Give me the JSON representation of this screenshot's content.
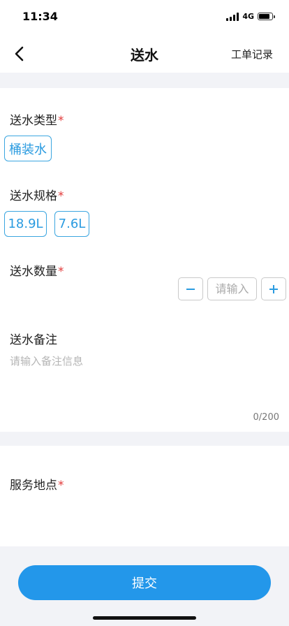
{
  "status_bar": {
    "time": "11:34",
    "network": "4G"
  },
  "nav": {
    "title": "送水",
    "action_label": "工单记录"
  },
  "form": {
    "water_type": {
      "label": "送水类型",
      "required_mark": "*",
      "options": [
        "桶装水"
      ]
    },
    "water_spec": {
      "label": "送水规格",
      "required_mark": "*",
      "options": [
        "18.9L",
        "7.6L"
      ]
    },
    "quantity": {
      "label": "送水数量",
      "required_mark": "*",
      "placeholder": "请输入",
      "decrement": "−",
      "increment": "+"
    },
    "remark": {
      "label": "送水备注",
      "placeholder": "请输入备注信息",
      "counter": "0/200"
    }
  },
  "location": {
    "label": "服务地点",
    "required_mark": "*"
  },
  "submit": {
    "label": "提交"
  },
  "colors": {
    "accent": "#2397ea",
    "chip_border": "#3ba6e0",
    "required": "#e23b3b"
  },
  "icons": {
    "back": "chevron-left-icon",
    "signal": "signal-icon",
    "battery": "battery-icon"
  }
}
